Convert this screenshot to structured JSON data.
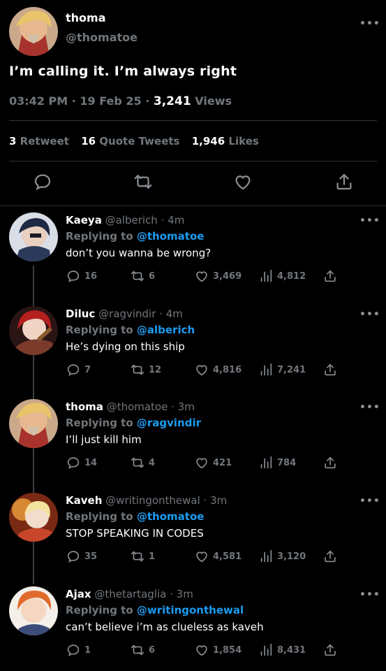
{
  "main_tweet": {
    "name": "thoma",
    "handle": "@thomatoe",
    "text": "I’m calling it. I’m always right",
    "time": "03:42 PM",
    "date": "19 Feb 25",
    "views_count": "3,241",
    "views_label": "Views",
    "retweet_count": "3",
    "retweet_label": "Retweet",
    "quote_count": "16",
    "quote_label": "Quote Tweets",
    "likes_count": "1,946",
    "likes_label": "Likes",
    "more": "•••"
  },
  "replies": [
    {
      "name": "Kaeya",
      "handle": "@alberich",
      "time": "4m",
      "replying_label": "Replying to",
      "replying_to": "@thomatoe",
      "text": "don’t you wanna be wrong?",
      "replies": "16",
      "retweets": "6",
      "likes": "3,469",
      "views": "4,812"
    },
    {
      "name": "Diluc",
      "handle": "@ragvindir",
      "time": "4m",
      "replying_label": "Replying to",
      "replying_to": "@alberich",
      "text": "He’s dying on this ship",
      "replies": "7",
      "retweets": "12",
      "likes": "4,816",
      "views": "7,241"
    },
    {
      "name": "thoma",
      "handle": "@thomatoe",
      "time": "3m",
      "replying_label": "Replying to",
      "replying_to": "@ragvindir",
      "text": "I’ll just kill him",
      "replies": "14",
      "retweets": "4",
      "likes": "421",
      "views": "784"
    },
    {
      "name": "Kaveh",
      "handle": "@writingonthewal",
      "time": "3m",
      "replying_label": "Replying to",
      "replying_to": "@thomatoe",
      "text": "STOP SPEAKING IN CODES",
      "replies": "35",
      "retweets": "1",
      "likes": "4,581",
      "views": "3,120"
    },
    {
      "name": "Ajax",
      "handle": "@thetartaglia",
      "time": "3m",
      "replying_label": "Replying to",
      "replying_to": "@writingonthewal",
      "text": "can’t believe i’m as clueless as kaveh",
      "replies": "1",
      "retweets": "6",
      "likes": "1,854",
      "views": "8,431"
    }
  ],
  "icons": {
    "reply": "reply-icon",
    "retweet": "retweet-icon",
    "like": "heart-icon",
    "views": "views-icon",
    "share": "share-icon",
    "more": "more-icon"
  },
  "colors": {
    "background": "#000000",
    "text": "#ffffff",
    "muted": "#71767b",
    "link": "#1d9bf0",
    "divider": "#2f3336"
  }
}
